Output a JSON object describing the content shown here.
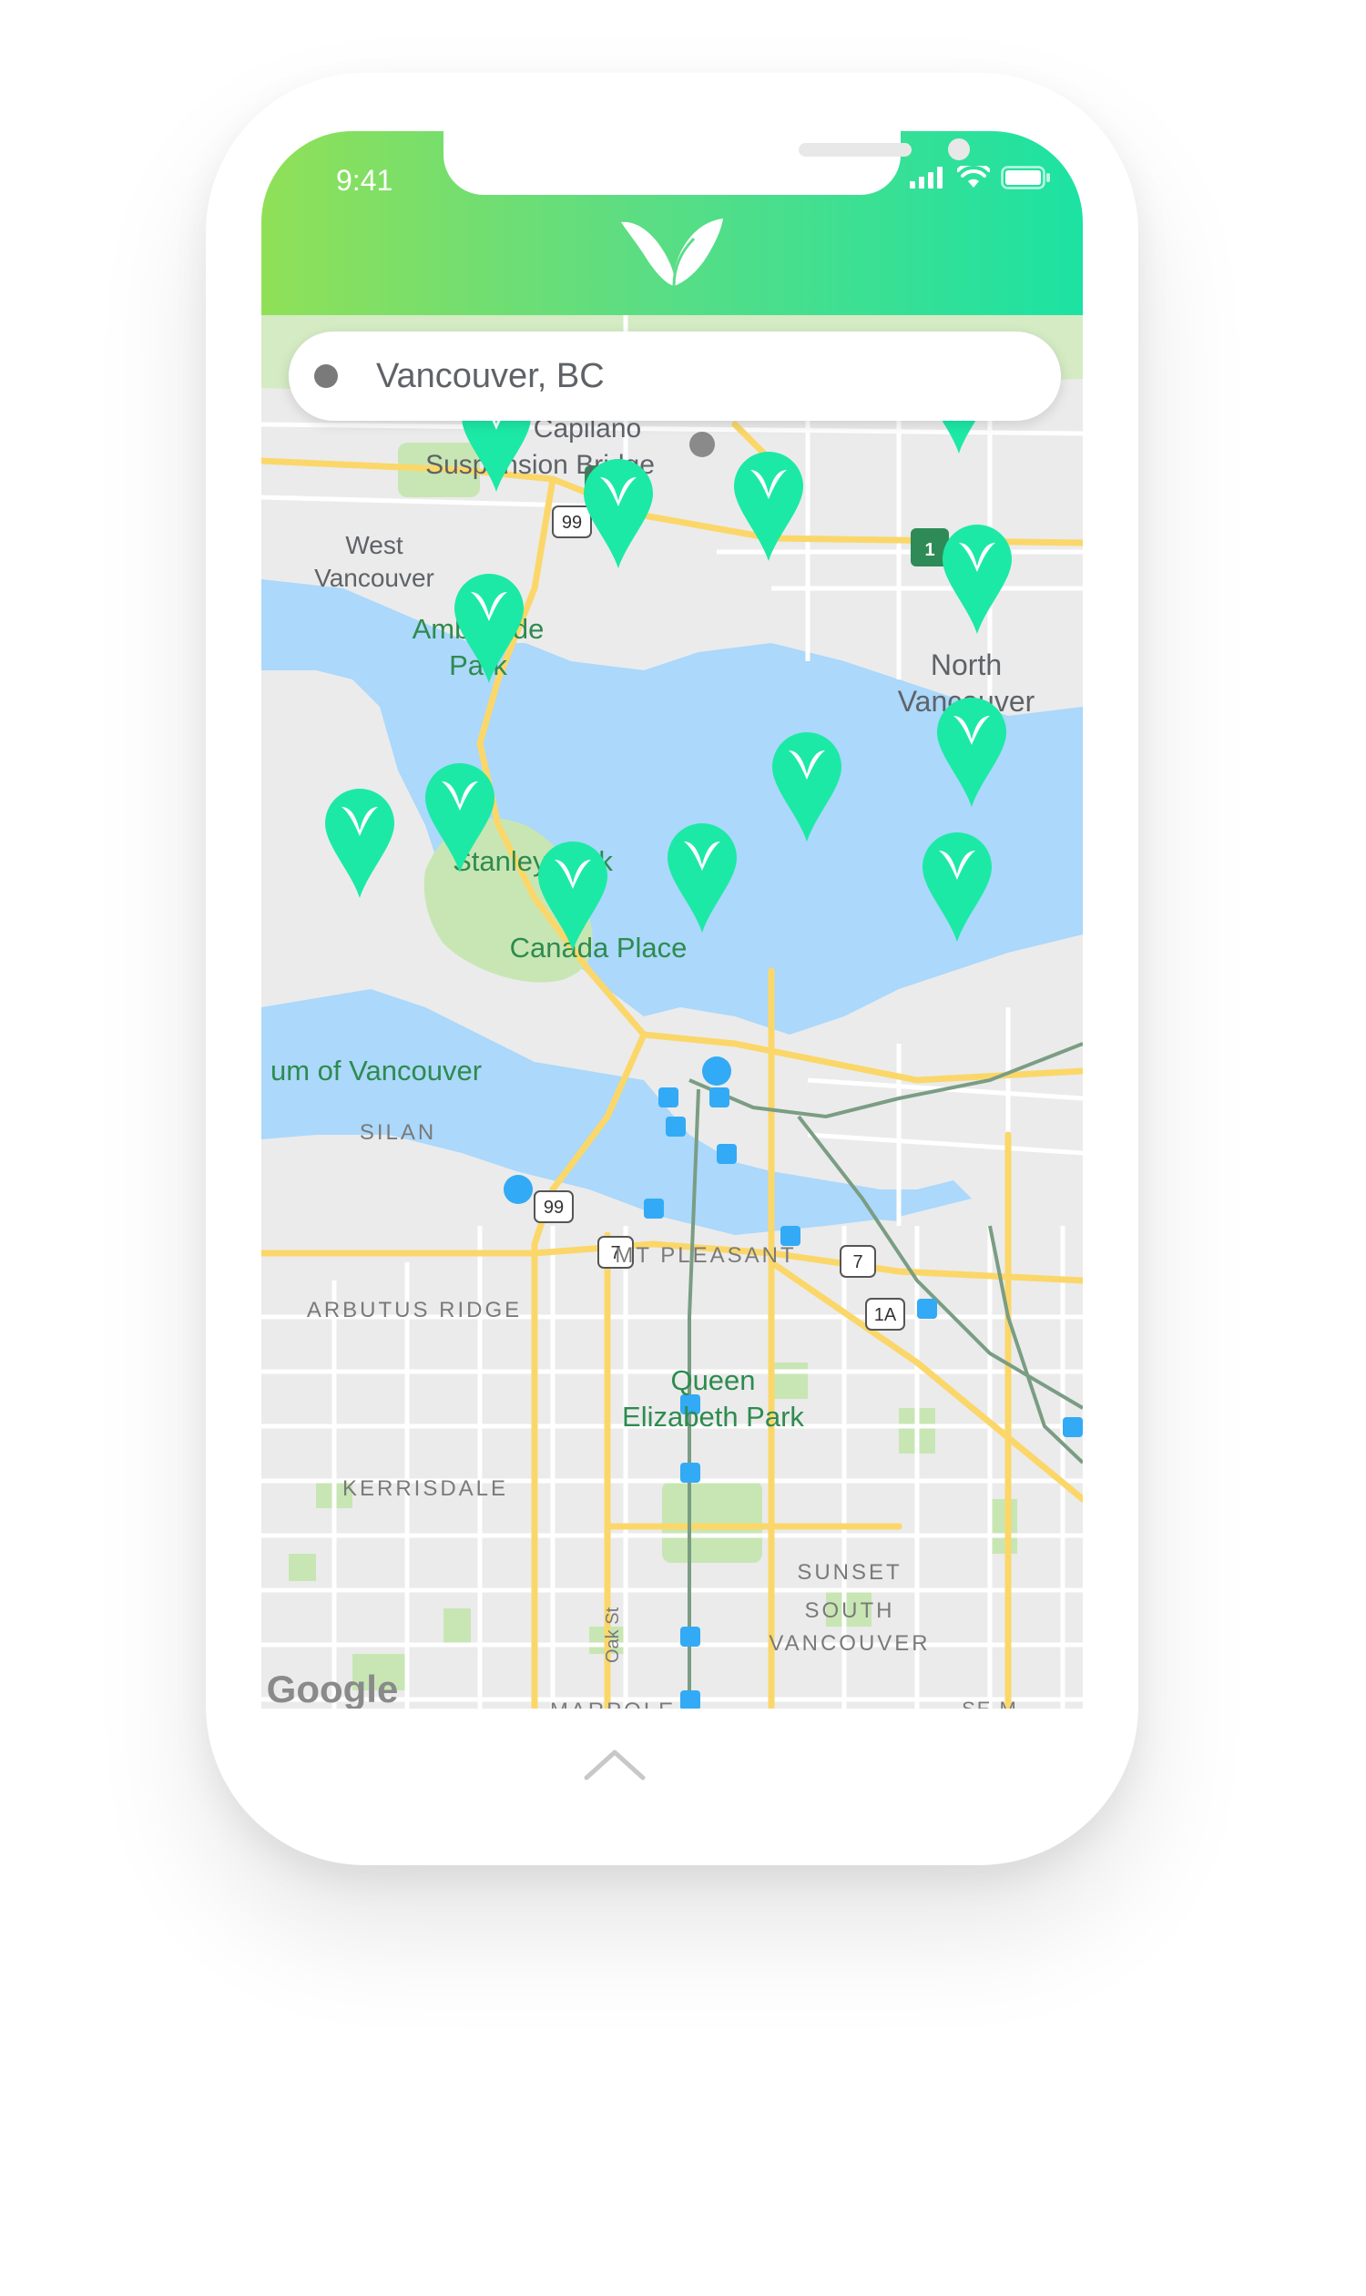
{
  "status_bar": {
    "time": "9:41"
  },
  "icons": {
    "logo": "v-leaf-logo-icon",
    "signal": "cellular-signal-icon",
    "wifi": "wifi-icon",
    "battery": "battery-icon",
    "search_dot": "location-dot-icon",
    "chevron": "chevron-up-icon",
    "marker": "map-marker-icon"
  },
  "search": {
    "value": "Vancouver, BC"
  },
  "map": {
    "attribution": "Google",
    "labels": {
      "capilano": "Capilano",
      "suspension_bridge": "Suspension Bridge",
      "west": "West",
      "west_vancouver": "Vancouver",
      "ambleside": "Ambleside",
      "ambleside_park": "Park",
      "north": "North",
      "north_vancouver": "Vancouver",
      "stanley_park": "Stanley Park",
      "canada_place": "Canada Place",
      "museum": "um of Vancouver",
      "kitsilano": "SILAN",
      "mt_pleasant": "MT PLEASANT",
      "arbutus_ridge": "ARBUTUS RIDGE",
      "queen": "Queen",
      "elizabeth_park": "Elizabeth Park",
      "kerrisdale": "KERRISDALE",
      "sunset": "SUNSET",
      "south": "SOUTH",
      "south_vancouver": "VANCOUVER",
      "oak_st": "Oak St",
      "marpole": "MARPOLE",
      "se_marine": "SE M"
    },
    "shields": {
      "hwy99_north": "99",
      "hwy99_south": "99",
      "hwy7_west": "7",
      "hwy7_east": "7",
      "hwy1a": "1A",
      "tch1_west": "1",
      "tch1_east": "1"
    }
  },
  "colors": {
    "brand_green": "#1de9a6",
    "gradient_start": "#90e057",
    "gradient_end": "#1ce2a3",
    "marker": "#1de9a6",
    "water": "#abd8fb",
    "park": "#c8e6b4",
    "road_major": "#fbd76a"
  }
}
